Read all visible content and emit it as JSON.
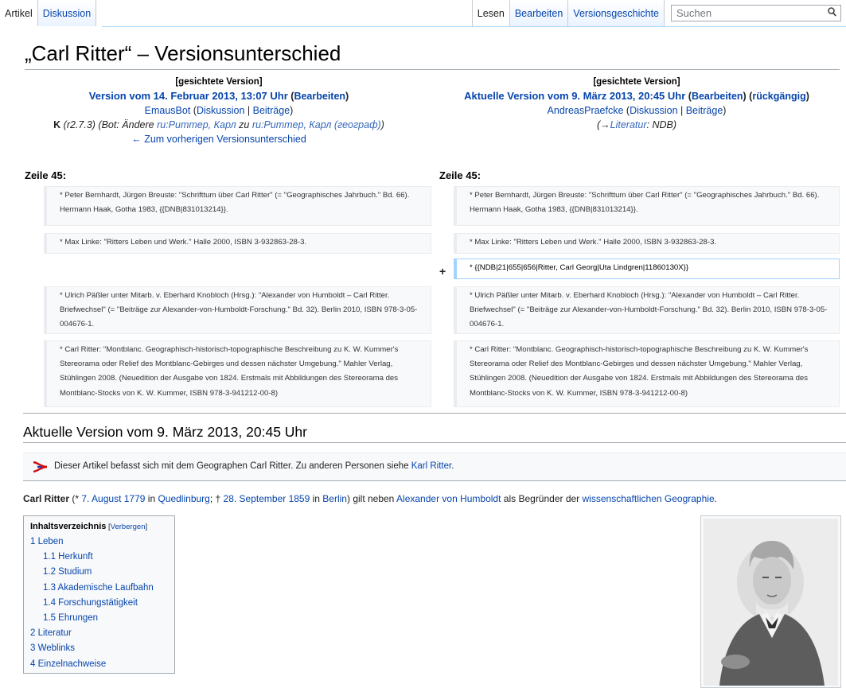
{
  "tabs_left": [
    {
      "label": "Artikel",
      "selected": true
    },
    {
      "label": "Diskussion",
      "selected": false
    }
  ],
  "tabs_right": [
    {
      "label": "Lesen",
      "selected": true
    },
    {
      "label": "Bearbeiten",
      "selected": false
    },
    {
      "label": "Versionsgeschichte",
      "selected": false
    }
  ],
  "search": {
    "placeholder": "Suchen",
    "icon": "search-icon"
  },
  "title": "„Carl Ritter“ – Versionsunterschied",
  "diff_left": {
    "badge": "[gesichtete Version]",
    "version": "Version vom 14. Februar 2013, 13:07 Uhr",
    "edit": "Bearbeiten",
    "user": "EmausBot",
    "talk": "Diskussion",
    "contribs": "Beiträge",
    "minor": "K",
    "comment_prefix": "(r2.7.3) (Bot: Ändere ",
    "comment_link1": "ru:Риттер, Карл",
    "comment_mid": " zu ",
    "comment_link2": "ru:Риттер, Карл (географ)",
    "comment_suffix": ")",
    "prev": "← Zum vorherigen Versionsunterschied"
  },
  "diff_right": {
    "badge": "[gesichtete Version]",
    "version": "Aktuelle Version vom 9. März 2013, 20:45 Uhr",
    "edit": "Bearbeiten",
    "undo": "rückgängig",
    "user": "AndreasPraefcke",
    "talk": "Diskussion",
    "contribs": "Beiträge",
    "comment_arrow": "(→",
    "comment_section": "Literatur",
    "comment_text": ": NDB)"
  },
  "zeile_left": "Zeile 45:",
  "zeile_right": "Zeile 45:",
  "diff_rows": [
    {
      "left": "* Peter Bernhardt, Jürgen Breuste: \"Schrifttum über Carl Ritter\" (= \"Geographisches Jahrbuch.\" Bd. 66). Hermann Haak, Gotha 1983, {{DNB|831013214}}.",
      "right": "* Peter Bernhardt, Jürgen Breuste: \"Schrifttum über Carl Ritter\" (= \"Geographisches Jahrbuch.\" Bd. 66). Hermann Haak, Gotha 1983, {{DNB|831013214}}."
    },
    {
      "left": "* Max Linke: \"Ritters Leben und Werk.\" Halle 2000, ISBN 3-932863-28-3.",
      "right": "* Max Linke: \"Ritters Leben und Werk.\" Halle 2000, ISBN 3-932863-28-3."
    },
    {
      "marker": "+",
      "right": "* {{NDB|21|655|656|Ritter, Carl Georg|Uta Lindgren|11860130X}}"
    },
    {
      "left": "* Ulrich Päßler unter Mitarb. v. Eberhard Knobloch (Hrsg.): \"Alexander von Humboldt – Carl Ritter. Briefwechsel\" (= \"Beiträge zur Alexander-von-Humboldt-Forschung.\" Bd. 32). Berlin 2010, ISBN 978-3-05-004676-1.",
      "right": "* Ulrich Päßler unter Mitarb. v. Eberhard Knobloch (Hrsg.): \"Alexander von Humboldt – Carl Ritter. Briefwechsel\" (= \"Beiträge zur Alexander-von-Humboldt-Forschung.\" Bd. 32). Berlin 2010, ISBN 978-3-05-004676-1."
    },
    {
      "left": "* Carl Ritter: \"Montblanc. Geographisch-historisch-topographische Beschreibung zu K. W. Kummer's Stereorama oder Relief des Montblanc-Gebirges und dessen nächster Umgebung.\" Mahler Verlag, Stühlingen 2008. (Neuedition der Ausgabe von 1824. Erstmals mit Abbildungen des Stereorama des Montblanc-Stocks von K. W. Kummer, ISBN 978-3-941212-00-8)",
      "right": "* Carl Ritter: \"Montblanc. Geographisch-historisch-topographische Beschreibung zu K. W. Kummer's Stereorama oder Relief des Montblanc-Gebirges und dessen nächster Umgebung.\" Mahler Verlag, Stühlingen 2008. (Neuedition der Ausgabe von 1824. Erstmals mit Abbildungen des Stereorama des Montblanc-Stocks von K. W. Kummer, ISBN 978-3-941212-00-8)"
    }
  ],
  "current_heading": "Aktuelle Version vom 9. März 2013, 20:45 Uhr",
  "hatnote": {
    "text": "Dieser Artikel befasst sich mit dem Geographen Carl Ritter. Zu anderen Personen siehe ",
    "link": "Karl Ritter",
    "end": "."
  },
  "lead": {
    "name": "Carl Ritter",
    "t1": " (* ",
    "birth_date": "7. August 1779",
    "t2": " in ",
    "birth_place": "Quedlinburg",
    "t3": "; † ",
    "death_date": "28. September 1859",
    "t4": " in ",
    "death_place": "Berlin",
    "t5": ") gilt neben ",
    "humboldt": "Alexander von Humboldt",
    "t6": " als Begründer der ",
    "geo": "wissenschaftlichen Geographie",
    "t7": "."
  },
  "toc": {
    "title": "Inhaltsverzeichnis",
    "toggle_open": " [",
    "toggle": "Verbergen",
    "toggle_close": "]",
    "items": [
      {
        "label": "1 Leben",
        "level": 1
      },
      {
        "label": "1.1 Herkunft",
        "level": 2
      },
      {
        "label": "1.2 Studium",
        "level": 2
      },
      {
        "label": "1.3 Akademische Laufbahn",
        "level": 2
      },
      {
        "label": "1.4 Forschungstätigkeit",
        "level": 2
      },
      {
        "label": "1.5 Ehrungen",
        "level": 2
      },
      {
        "label": "2 Literatur",
        "level": 1
      },
      {
        "label": "3 Weblinks",
        "level": 1
      },
      {
        "label": "4 Einzelnachweise",
        "level": 1
      }
    ]
  },
  "colors": {
    "link": "#0645ad",
    "border": "#a2a9b1",
    "diff_added": "#a3d3ff",
    "diff_context": "#eaecf0"
  }
}
